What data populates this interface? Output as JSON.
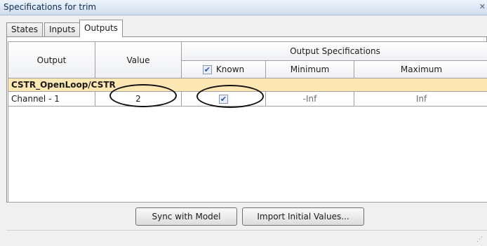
{
  "window": {
    "title": "Specifications for trim"
  },
  "tabs": [
    {
      "label": "States"
    },
    {
      "label": "Inputs"
    },
    {
      "label": "Outputs",
      "active": true
    }
  ],
  "table": {
    "headers": {
      "output": "Output",
      "value": "Value",
      "group": "Output Specifications",
      "known": "Known",
      "minimum": "Minimum",
      "maximum": "Maximum"
    },
    "group_label": "CSTR_OpenLoop/CSTR",
    "rows": [
      {
        "output": "Channel - 1",
        "value": "2",
        "known": true,
        "minimum": "-Inf",
        "maximum": "Inf"
      }
    ]
  },
  "buttons": {
    "sync": "Sync with Model",
    "import": "Import Initial Values..."
  },
  "colors": {
    "group_row": "#fde7b2",
    "title_bar": "#dbe6f4"
  }
}
